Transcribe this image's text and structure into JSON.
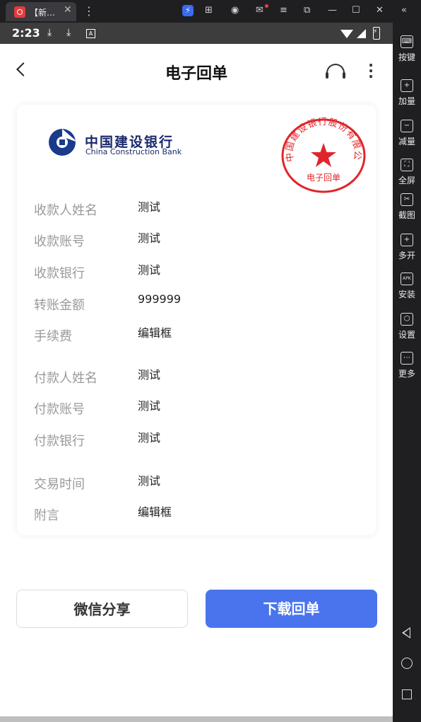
{
  "window": {
    "tab_title": "【新…",
    "tab_close": "✕",
    "menu": "⋮",
    "icons": [
      "bolt-icon",
      "gamepad-icon",
      "account-icon",
      "mail-icon",
      "menu-icon",
      "screenshot-icon",
      "minimize-icon",
      "maximize-icon",
      "close-icon"
    ],
    "glyphs": {
      "bolt": "⚡",
      "gamepad": "⊞",
      "account": "◉",
      "mail": "✉",
      "menu": "≡",
      "screenshot": "⧉",
      "minimize": "—",
      "maximize": "☐",
      "close": "✕",
      "collapse": "«"
    }
  },
  "status_bar": {
    "time": "2:23",
    "icons": [
      "download-icon",
      "download-icon",
      "a-icon",
      "wifi-icon",
      "signal-icon",
      "battery-icon"
    ],
    "download_glyph": "⤓",
    "a_glyph": "A"
  },
  "header": {
    "title": "电子回单"
  },
  "receipt": {
    "bank_name_cn": "中国建设银行",
    "bank_name_en": "China Construction Bank",
    "seal_text": "中国建设银行股份有限公司",
    "seal_caption": "电子回单",
    "seal_color": "#e0262b",
    "rows": [
      {
        "label": "收款人姓名",
        "value": "测试"
      },
      {
        "label": "收款账号",
        "value": "测试"
      },
      {
        "label": "收款银行",
        "value": "测试"
      },
      {
        "label": "转账金额",
        "value": "999999"
      },
      {
        "label": "手续费",
        "value": "编辑框"
      },
      {
        "label": "付款人姓名",
        "value": "测试"
      },
      {
        "label": "付款账号",
        "value": "测试"
      },
      {
        "label": "付款银行",
        "value": "测试"
      },
      {
        "label": "交易时间",
        "value": "测试"
      },
      {
        "label": "附言",
        "value": "编辑框"
      }
    ]
  },
  "actions": {
    "share": "微信分享",
    "download": "下载回单",
    "download_color": "#4a74ee"
  },
  "sidebar": {
    "items": [
      {
        "label": "按键",
        "icon": "keyboard-icon",
        "glyph": "⌨"
      },
      {
        "label": "加量",
        "icon": "volume-up-icon",
        "glyph": "+"
      },
      {
        "label": "减量",
        "icon": "volume-down-icon",
        "glyph": "−"
      },
      {
        "label": "全屏",
        "icon": "fullscreen-icon",
        "glyph": "⛶"
      },
      {
        "label": "截图",
        "icon": "scissors-icon",
        "glyph": "✂"
      },
      {
        "label": "多开",
        "icon": "multi-instance-icon",
        "glyph": "+"
      },
      {
        "label": "安装",
        "icon": "apk-icon",
        "glyph": "APK"
      },
      {
        "label": "设置",
        "icon": "settings-icon",
        "glyph": "⬡"
      },
      {
        "label": "更多",
        "icon": "more-icon",
        "glyph": "⋯"
      }
    ]
  }
}
